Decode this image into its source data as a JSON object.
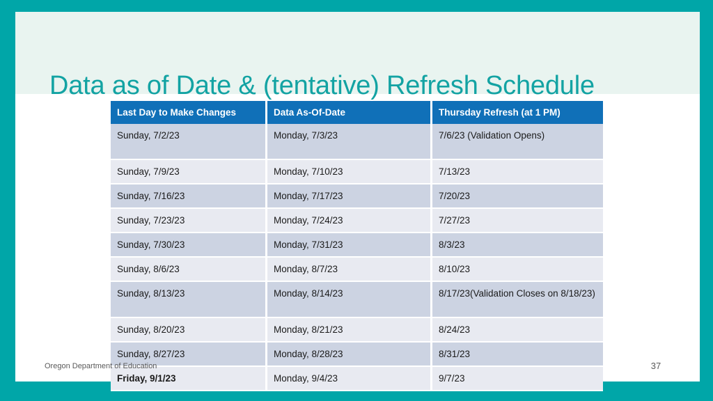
{
  "theme": {
    "frame_color": "#00a6a8",
    "title_band_color": "#e9f4f0",
    "title_color": "#13a3a3",
    "table_header_color": "#1070b8",
    "row_band_dark": "#ccd3e2",
    "row_band_light": "#e8eaf1"
  },
  "slide": {
    "title": "Data as of Date & (tentative) Refresh Schedule"
  },
  "table": {
    "headers": [
      "Last Day to Make Changes",
      "Data As-Of-Date",
      "Thursday Refresh (at 1 PM)"
    ],
    "rows": [
      {
        "last_day": "Sunday, 7/2/23",
        "as_of": "Monday, 7/3/23",
        "refresh": "7/6/23 (Validation Opens)",
        "band": "dark",
        "tall": true,
        "bold_first": false
      },
      {
        "last_day": "Sunday, 7/9/23",
        "as_of": "Monday, 7/10/23",
        "refresh": "7/13/23",
        "band": "light",
        "tall": false,
        "bold_first": false
      },
      {
        "last_day": "Sunday, 7/16/23",
        "as_of": "Monday,  7/17/23",
        "refresh": "7/20/23",
        "band": "dark",
        "tall": false,
        "bold_first": false
      },
      {
        "last_day": "Sunday, 7/23/23",
        "as_of": "Monday, 7/24/23",
        "refresh": "7/27/23",
        "band": "light",
        "tall": false,
        "bold_first": false
      },
      {
        "last_day": "Sunday, 7/30/23",
        "as_of": "Monday, 7/31/23",
        "refresh": "8/3/23",
        "band": "dark",
        "tall": false,
        "bold_first": false
      },
      {
        "last_day": "Sunday, 8/6/23",
        "as_of": "Monday, 8/7/23",
        "refresh": "8/10/23",
        "band": "light",
        "tall": false,
        "bold_first": false
      },
      {
        "last_day": "Sunday, 8/13/23",
        "as_of": "Monday, 8/14/23",
        "refresh": "8/17/23(Validation Closes on 8/18/23)",
        "band": "dark",
        "tall": true,
        "bold_first": false
      },
      {
        "last_day": "Sunday, 8/20/23",
        "as_of": "Monday, 8/21/23",
        "refresh": "8/24/23",
        "band": "light",
        "tall": false,
        "bold_first": false
      },
      {
        "last_day": "Sunday, 8/27/23",
        "as_of": "Monday, 8/28/23",
        "refresh": "8/31/23",
        "band": "dark",
        "tall": false,
        "bold_first": false
      },
      {
        "last_day": "Friday, 9/1/23",
        "as_of": "Monday, 9/4/23",
        "refresh": "9/7/23",
        "band": "light",
        "tall": false,
        "bold_first": true
      }
    ]
  },
  "footer": {
    "organization": "Oregon Department of Education",
    "page_number": "37"
  }
}
